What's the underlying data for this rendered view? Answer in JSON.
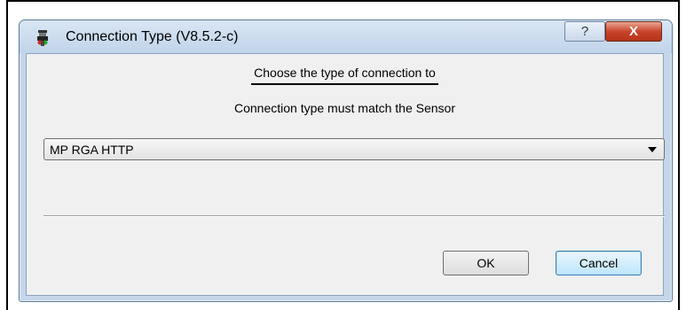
{
  "window": {
    "title": "Connection Type  (V8.5.2-c)",
    "help_label": "?",
    "close_label": "X",
    "icon": "sensor-icon"
  },
  "dialog": {
    "heading": "Choose the type of connection to",
    "subtext": "Connection type must match the Sensor",
    "connection_select": {
      "selected": "MP RGA HTTP"
    }
  },
  "buttons": {
    "ok": "OK",
    "cancel": "Cancel"
  },
  "colors": {
    "title_bar": "#c5d6ea",
    "close_button": "#c8452c",
    "client_bg": "#f0f0f0"
  }
}
